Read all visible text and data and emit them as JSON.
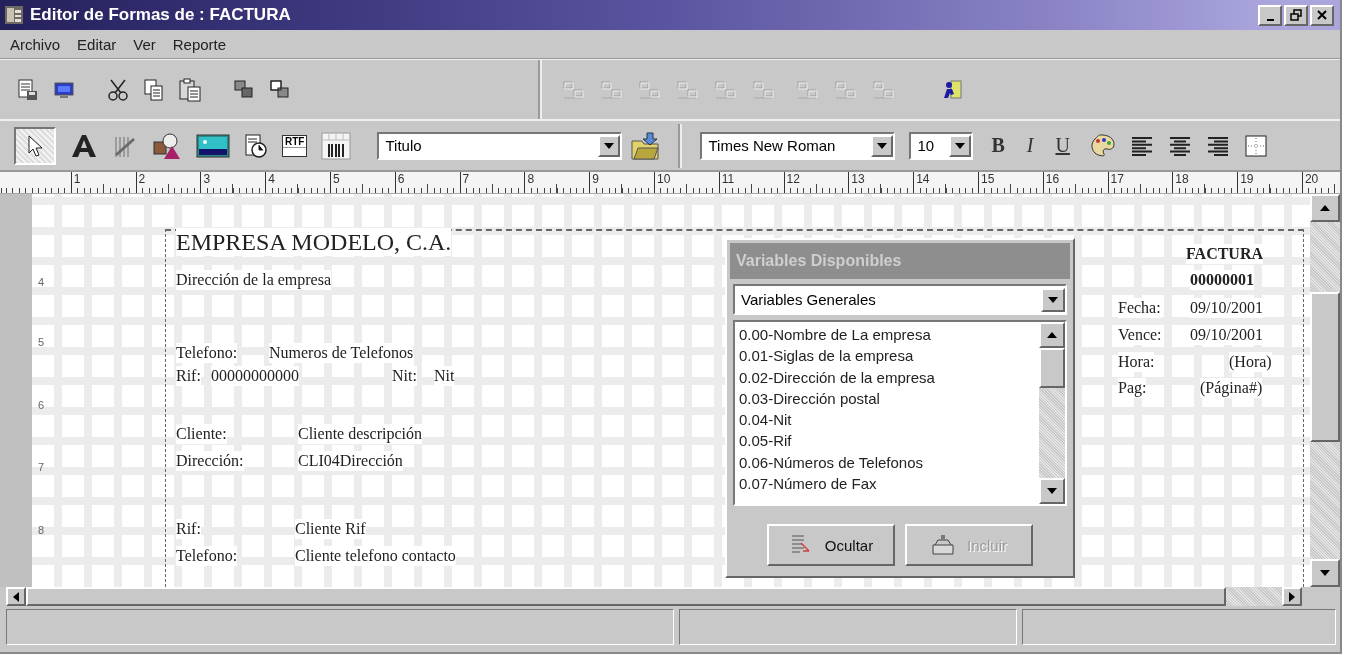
{
  "window": {
    "title": "Editor de Formas de : FACTURA"
  },
  "menu": [
    {
      "label": "Archivo"
    },
    {
      "label": "Editar"
    },
    {
      "label": "Ver"
    },
    {
      "label": "Reporte"
    }
  ],
  "format_toolbar": {
    "rtf_label": "RTF",
    "style": "Titulo",
    "font": "Times New Roman",
    "size": "10",
    "format_buttons": [
      "B",
      "I",
      "U"
    ]
  },
  "ruler": [
    "1",
    "2",
    "3",
    "4",
    "5",
    "6",
    "7",
    "8",
    "9",
    "10",
    "11",
    "12",
    "13",
    "14",
    "15",
    "16",
    "17",
    "18",
    "19",
    "20"
  ],
  "line_numbers": [
    "4",
    "5",
    "6",
    "7",
    "8"
  ],
  "form_fields": [
    {
      "text": "EMPRESA MODELO, C.A.",
      "kind": "title"
    },
    {
      "text": "Dirección de la empresa",
      "kind": "text"
    },
    {
      "text": "Telefono:",
      "kind": "text"
    },
    {
      "text": "Numeros de Telefonos",
      "kind": "text"
    },
    {
      "text": "Rif:",
      "kind": "text"
    },
    {
      "text": "00000000000",
      "kind": "text"
    },
    {
      "text": "Nit:",
      "kind": "text"
    },
    {
      "text": "Nit",
      "kind": "text"
    },
    {
      "text": "Cliente:",
      "kind": "text"
    },
    {
      "text": "Cliente descripción",
      "kind": "text"
    },
    {
      "text": "Dirección:",
      "kind": "text"
    },
    {
      "text": "CLI04Dirección",
      "kind": "text"
    },
    {
      "text": "Rif:",
      "kind": "text"
    },
    {
      "text": "Cliente Rif",
      "kind": "text"
    },
    {
      "text": "Telefono:",
      "kind": "text"
    },
    {
      "text": "Cliente telefono contacto",
      "kind": "text"
    },
    {
      "text": "FACTURA",
      "kind": "bold"
    },
    {
      "text": "00000001",
      "kind": "bold"
    },
    {
      "text": "Fecha:",
      "kind": "text"
    },
    {
      "text": "09/10/2001",
      "kind": "text"
    },
    {
      "text": "Vence:",
      "kind": "text"
    },
    {
      "text": "09/10/2001",
      "kind": "text"
    },
    {
      "text": "Hora:",
      "kind": "text"
    },
    {
      "text": "(Hora)",
      "kind": "text"
    },
    {
      "text": "Pag:",
      "kind": "text"
    },
    {
      "text": "(Página#)",
      "kind": "text"
    }
  ],
  "variables_panel": {
    "title": "Variables Disponibles",
    "category": "Variables Generales",
    "items": [
      "0.00-Nombre de La empresa",
      "0.01-Siglas de la empresa",
      "0.02-Dirección de la empresa",
      "0.03-Dirección postal",
      "0.04-Nit",
      "0.05-Rif",
      "0.06-Números de Telefonos",
      "0.07-Número de Fax"
    ],
    "buttons": [
      {
        "label": "Ocultar",
        "disabled": false
      },
      {
        "label": "Incluir",
        "disabled": true
      }
    ]
  }
}
